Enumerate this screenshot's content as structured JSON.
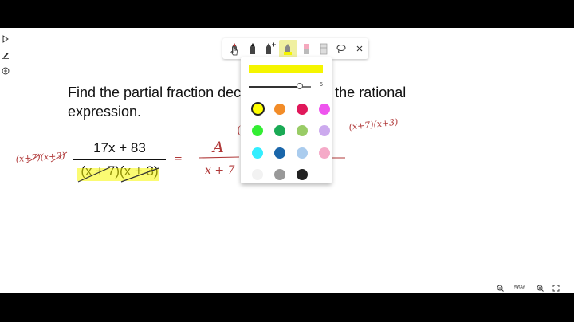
{
  "problem": {
    "text": "Find the partial fraction decomposition for the rational expression.",
    "numerator": "17x + 83",
    "denominator": "(x + 7)(x + 3)"
  },
  "handwriting": {
    "left_factors": "(x+7)(x+3)",
    "equals": "=",
    "term_a_numerator": "A",
    "term_a_denominator": "x + 7",
    "right_factors": "(x+7)(x+3)"
  },
  "left_tools": [
    {
      "name": "select-arrow-icon"
    },
    {
      "name": "pen-icon"
    },
    {
      "name": "add-circle-icon"
    }
  ],
  "toolbar": {
    "tools": [
      {
        "name": "red-pen-icon"
      },
      {
        "name": "black-pen-icon"
      },
      {
        "name": "pen-plus-icon"
      },
      {
        "name": "highlighter-icon"
      },
      {
        "name": "pink-eraser-icon"
      },
      {
        "name": "eraser-icon"
      },
      {
        "name": "lasso-icon"
      },
      {
        "name": "close-icon"
      }
    ],
    "highlight_color": "#f5f500"
  },
  "color_panel": {
    "size_value": "5",
    "size_fraction": 0.82,
    "selected_color": "#ffff00",
    "colors": [
      "#ffff00",
      "#f28c28",
      "#e0185a",
      "#ee55ee",
      "#33ee33",
      "#1aaa55",
      "#99cc66",
      "#ccaaee",
      "#33eeff",
      "#1a66aa",
      "#aaccee",
      "#f5aac8",
      "#f2f2f2",
      "#999999",
      "#222222",
      "#ffffff"
    ]
  },
  "zoom": {
    "level": "56%"
  }
}
